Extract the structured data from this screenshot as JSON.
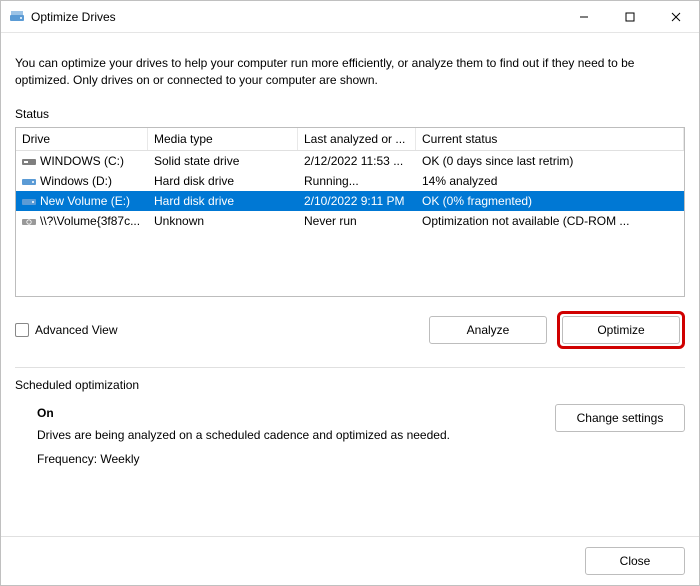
{
  "window": {
    "title": "Optimize Drives"
  },
  "intro": "You can optimize your drives to help your computer run more efficiently, or analyze them to find out if they need to be optimized. Only drives on or connected to your computer are shown.",
  "status_label": "Status",
  "columns": {
    "drive": "Drive",
    "media": "Media type",
    "last": "Last analyzed or ...",
    "status": "Current status"
  },
  "drives": [
    {
      "name": "WINDOWS (C:)",
      "media": "Solid state drive",
      "last": "2/12/2022 11:53 ...",
      "status": "OK (0 days since last retrim)",
      "icon": "ssd",
      "selected": false
    },
    {
      "name": "Windows (D:)",
      "media": "Hard disk drive",
      "last": "Running...",
      "status": "14% analyzed",
      "icon": "hdd",
      "selected": false
    },
    {
      "name": "New Volume (E:)",
      "media": "Hard disk drive",
      "last": "2/10/2022 9:11 PM",
      "status": "OK (0% fragmented)",
      "icon": "hdd",
      "selected": true
    },
    {
      "name": "\\\\?\\Volume{3f87c...",
      "media": "Unknown",
      "last": "Never run",
      "status": "Optimization not available (CD-ROM ...",
      "icon": "cd",
      "selected": false
    }
  ],
  "advanced_view_label": "Advanced View",
  "buttons": {
    "analyze": "Analyze",
    "optimize": "Optimize",
    "change": "Change settings",
    "close": "Close"
  },
  "scheduled": {
    "heading": "Scheduled optimization",
    "state": "On",
    "desc": "Drives are being analyzed on a scheduled cadence and optimized as needed.",
    "frequency": "Frequency: Weekly"
  }
}
